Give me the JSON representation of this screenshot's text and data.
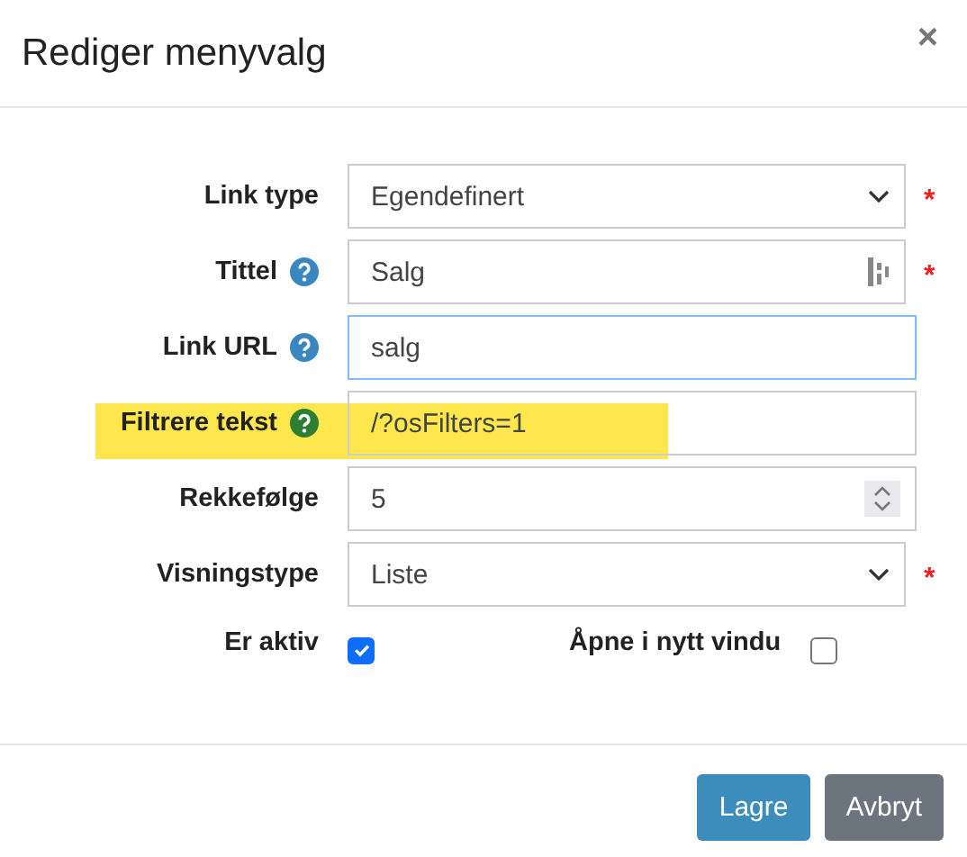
{
  "dialog": {
    "title": "Rediger menyvalg",
    "close": "×"
  },
  "required_mark": "*",
  "fields": [
    {
      "label": "Link type",
      "kind": "select",
      "value": "Egendefinert",
      "required": true,
      "help": false,
      "focused": false,
      "highlighted": false
    },
    {
      "label": "Tittel",
      "kind": "text",
      "value": "Salg",
      "required": true,
      "help": true,
      "color": "#3a87c0",
      "focused": false,
      "highlighted": false,
      "field_icon": true
    },
    {
      "label": "Link URL",
      "kind": "text",
      "value": "salg",
      "required": false,
      "help": true,
      "color": "#3a87c0",
      "focused": true,
      "highlighted": false
    },
    {
      "label": "Filtrere tekst",
      "kind": "text",
      "value": "/?osFilters=1",
      "required": false,
      "help": true,
      "color": "#2e7d32",
      "focused": false,
      "highlighted": true
    },
    {
      "label": "Rekkefølge",
      "kind": "number",
      "value": "5",
      "required": false,
      "help": false,
      "focused": false,
      "highlighted": false
    },
    {
      "label": "Visningstype",
      "kind": "select",
      "value": "Liste",
      "required": true,
      "help": false,
      "focused": false,
      "highlighted": false
    }
  ],
  "checkboxes": [
    {
      "label": "Er aktiv",
      "checked": true
    },
    {
      "label": "Åpne i nytt vindu",
      "checked": false
    }
  ],
  "buttons": [
    {
      "label": "Lagre",
      "kind": "primary"
    },
    {
      "label": "Avbryt",
      "kind": "secondary"
    }
  ]
}
